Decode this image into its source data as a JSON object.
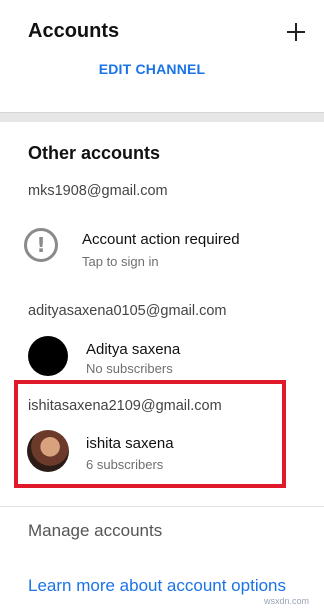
{
  "header": {
    "title": "Accounts",
    "edit_channel": "EDIT CHANNEL",
    "add_icon": "plus-icon"
  },
  "other_accounts": {
    "title": "Other accounts",
    "accounts": [
      {
        "email": "mks1908@gmail.com",
        "name": "Account action required",
        "status": "Tap to sign in",
        "icon": "alert-icon"
      },
      {
        "email": "adityasaxena0105@gmail.com",
        "name": "Aditya saxena",
        "status": "No subscribers",
        "avatar": "black-circle"
      },
      {
        "email": "ishitasaxena2109@gmail.com",
        "name": "ishita saxena",
        "status": "6 subscribers",
        "avatar": "photo"
      }
    ]
  },
  "footer": {
    "manage": "Manage accounts",
    "learn_more": "Learn more about account options"
  },
  "watermark": "wsxdn.com",
  "colors": {
    "accent": "#1a73e8",
    "highlight": "#e0192b"
  }
}
